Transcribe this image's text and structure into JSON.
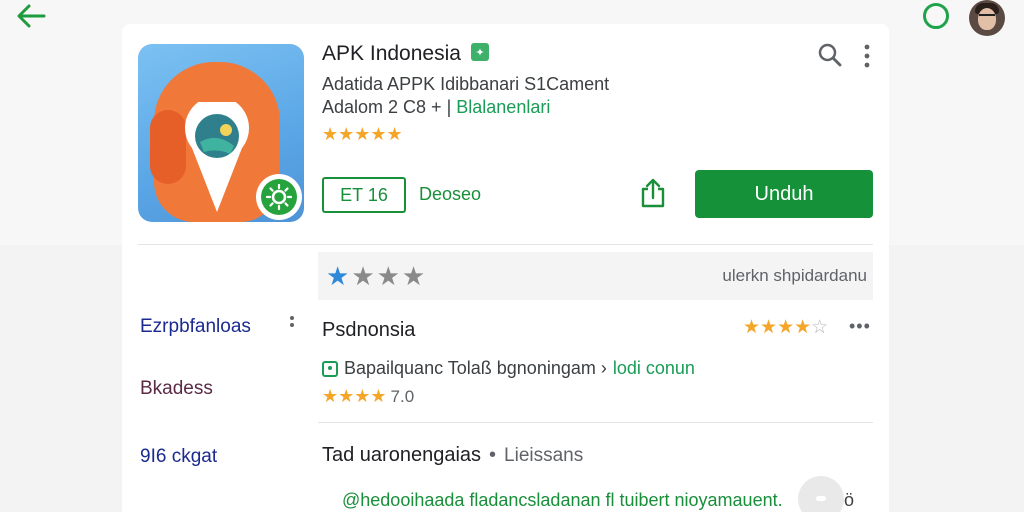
{
  "app": {
    "title": "APK Indonesia",
    "verified_glyph": "✦",
    "meta_line1": "Adatida APPK Idibbanari S1Cament",
    "meta_line2_prefix": "Adalom 2 C8 + |",
    "meta_line2_developer": "Blalanenlari",
    "stars": "★★★★★",
    "rating_pill": "ET 16",
    "description_link": "Deoseo",
    "install_label": "Unduh"
  },
  "rating_strip": {
    "filled": "★",
    "empty": "★★★",
    "label": "ulerkn shpidardanu"
  },
  "sidebar": {
    "items": [
      {
        "label": "Ezrpbfanloas"
      },
      {
        "label": "Bkadess"
      },
      {
        "label": "9I6 ckgat"
      }
    ]
  },
  "listing": {
    "title": "Psdnonsia",
    "stars_filled": "★★★★",
    "stars_empty": "☆",
    "more": "•••",
    "subtitle": "Bapailquanc Tolaß bgnoningam ›",
    "subtitle_link": "lodi conun",
    "rating_stars": "★★★★",
    "rating_value": "7.0"
  },
  "section": {
    "title": "Tad uaronengaias",
    "separator": "•",
    "subtitle": "Lieissans"
  },
  "footer": {
    "link": "@hedooihaada fladancsladanan fl tuibert nioyamauent.",
    "tail": "ö"
  },
  "icons": [
    "back-arrow-icon",
    "status-circle-icon",
    "avatar",
    "search-icon",
    "more-vert-icon",
    "share-icon",
    "verified-icon"
  ],
  "colors": {
    "accent": "#159239",
    "star": "#f4a62a",
    "link": "#1a9c56"
  }
}
